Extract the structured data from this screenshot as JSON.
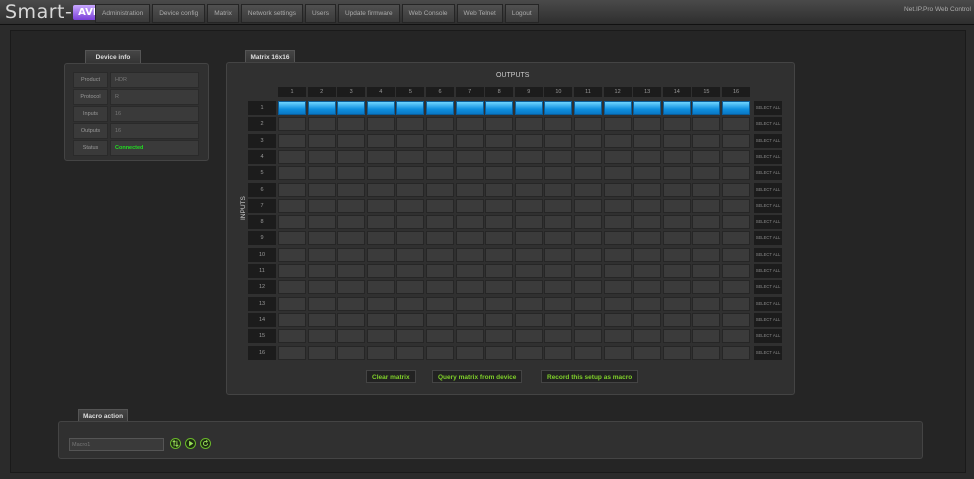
{
  "logo": {
    "text": "Smart-",
    "badge": "AVI"
  },
  "nav": [
    "Administration",
    "Device config",
    "Matrix",
    "Network settings",
    "Users",
    "Update firmware",
    "Web Console",
    "Web Telnet",
    "Logout"
  ],
  "brand_right": "Net.IP.Pro Web Control",
  "device_info": {
    "tab": "Device info",
    "rows": [
      {
        "label": "Product",
        "value": "HDR"
      },
      {
        "label": "Protocol",
        "value": "R"
      },
      {
        "label": "Inputs",
        "value": "16"
      },
      {
        "label": "Outputs",
        "value": "16"
      },
      {
        "label": "Status",
        "value": "Connected"
      }
    ],
    "status_color": "#22dd22"
  },
  "matrix": {
    "tab": "Matrix 16x16",
    "outputs_label": "OUTPUTS",
    "inputs_label": "INPUTS",
    "columns": [
      "1",
      "2",
      "3",
      "4",
      "5",
      "6",
      "7",
      "8",
      "9",
      "10",
      "11",
      "12",
      "13",
      "14",
      "15",
      "16"
    ],
    "rows": [
      "1",
      "2",
      "3",
      "4",
      "5",
      "6",
      "7",
      "8",
      "9",
      "10",
      "11",
      "12",
      "13",
      "14",
      "15",
      "16"
    ],
    "select_all_label": "SELECT ALL",
    "active_input": "1",
    "active_color": "#0e8fe0",
    "buttons": [
      "Clear matrix",
      "Query matrix from device",
      "Record this setup as macro"
    ]
  },
  "macro": {
    "tab": "Macro action",
    "value": "Macro1",
    "icons": [
      "sort-icon",
      "play-icon",
      "refresh-icon"
    ]
  }
}
